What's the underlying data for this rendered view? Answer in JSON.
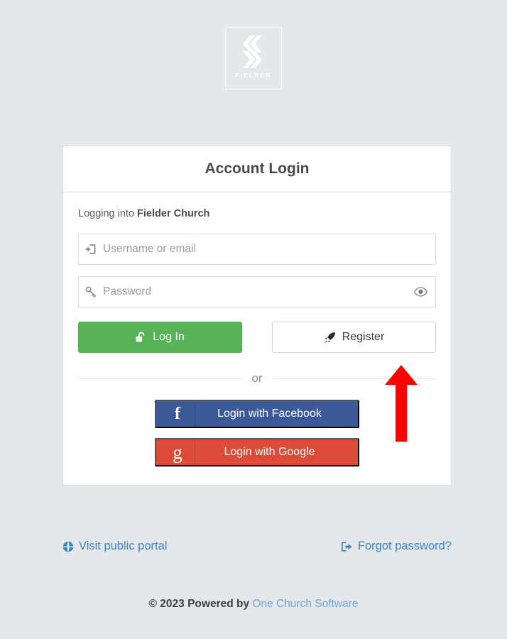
{
  "page": {
    "background_color": "#e4e8ea"
  },
  "logo": {
    "wordmark": "FIELDER",
    "icon": "fielder-chevron-logo",
    "color": "#ffffff"
  },
  "card": {
    "title": "Account Login",
    "subtitle_prefix": "Logging into ",
    "organization": "Fielder Church",
    "fields": [
      {
        "name": "username",
        "placeholder": "Username or email",
        "value": "",
        "icon": "sign-in-icon"
      },
      {
        "name": "password",
        "placeholder": "Password",
        "value": "",
        "icon": "key-icon",
        "toggle_icon": "eye-icon"
      }
    ],
    "buttons": {
      "login_label": "Log In",
      "login_icon": "unlock-icon",
      "login_color": "#56b356",
      "register_label": "Register",
      "register_icon": "rocket-icon"
    },
    "divider_text": "or",
    "social_buttons": [
      {
        "label": "Login with Facebook",
        "glyph": "f",
        "icon": "facebook-icon",
        "color": "#3b5998"
      },
      {
        "label": "Login with Google",
        "glyph": "g",
        "icon": "google-icon",
        "color": "#dd4b39"
      }
    ]
  },
  "links": {
    "public_portal_label": "Visit public portal",
    "public_portal_icon": "globe-icon",
    "forgot_password_label": "Forgot password?",
    "forgot_password_icon": "sign-out-icon",
    "color": "#3f85c6"
  },
  "footer": {
    "copyright": "© 2023 Powered by",
    "brand": "One Church Software"
  },
  "annotation": {
    "type": "arrow",
    "direction": "up",
    "color": "#ff0000",
    "points_at": "Register"
  }
}
